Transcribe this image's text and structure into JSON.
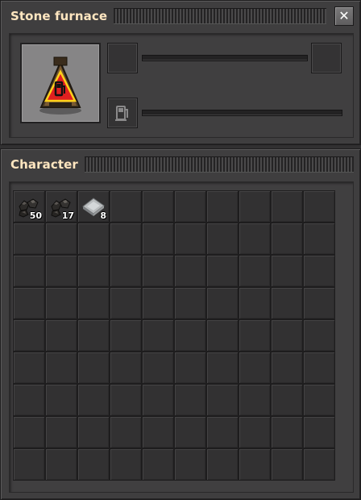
{
  "furnace_window": {
    "title": "Stone furnace",
    "close_icon": "x-icon",
    "entity_icon": "stone-furnace-no-fuel-icon",
    "fuel_slot_icon": "fuel-pump-icon",
    "source_progress": 0,
    "fuel_progress": 0
  },
  "character_window": {
    "title": "Character",
    "grid_columns": 10,
    "grid_rows": 9,
    "items": [
      {
        "name": "coal",
        "icon": "coal-icon",
        "count": "50"
      },
      {
        "name": "coal",
        "icon": "coal-icon",
        "count": "17"
      },
      {
        "name": "iron-plate",
        "icon": "iron-plate-icon",
        "count": "8"
      }
    ]
  },
  "colors": {
    "title_text": "#ffe6c0",
    "window_bg": "#3f3e3f",
    "slot_bg": "#323132",
    "warning_red": "#e02020"
  }
}
